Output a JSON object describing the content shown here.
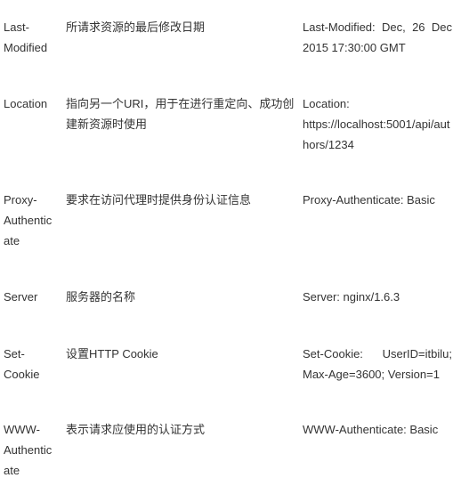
{
  "rows": [
    {
      "name": "Last-\nModified",
      "desc": "所请求资源的最后修改日期",
      "example": "Last-Modified: Dec, 26 Dec 2015 17:30:00 GMT"
    },
    {
      "name": "Location",
      "desc": "指向另一个URI，用于在进行重定向、成功创建新资源时使用",
      "example": "Location: https://localhost:5001/api/authors/1234"
    },
    {
      "name": "Proxy-Authenticate",
      "desc": "要求在访问代理时提供身份认证信息",
      "example": "Proxy-Authenticate: Basic"
    },
    {
      "name": "Server",
      "desc": "服务器的名称",
      "example": "Server: nginx/1.6.3"
    },
    {
      "name": "Set-Cookie",
      "desc": "设置HTTP Cookie",
      "example": "Set-Cookie: UserID=itbilu; Max-Age=3600; Version=1"
    },
    {
      "name": "WWW-Authenticate",
      "desc": "表示请求应使用的认证方式",
      "example": "WWW-Authenticate: Basic"
    }
  ]
}
